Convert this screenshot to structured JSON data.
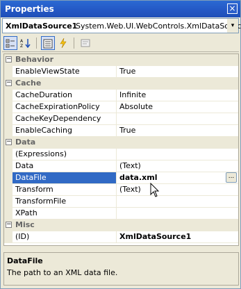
{
  "window": {
    "title": "Properties",
    "close_glyph": "×"
  },
  "object_selector": {
    "name": "XmlDataSource1",
    "type": "System.Web.UI.WebControls.XmlDataSource",
    "dropdown_glyph": "▾"
  },
  "toolbar": {
    "buttons": [
      {
        "icon": "categorized-icon",
        "pressed": true
      },
      {
        "icon": "alphabetical-icon",
        "pressed": false
      },
      {
        "icon": "properties-icon",
        "pressed": true
      },
      {
        "icon": "events-icon",
        "pressed": false
      },
      {
        "icon": "property-pages-icon",
        "pressed": false
      }
    ]
  },
  "grid": {
    "categories": [
      {
        "label": "Behavior",
        "toggle": "−",
        "props": [
          {
            "name": "EnableViewState",
            "value": "True"
          }
        ]
      },
      {
        "label": "Cache",
        "toggle": "−",
        "props": [
          {
            "name": "CacheDuration",
            "value": "Infinite"
          },
          {
            "name": "CacheExpirationPolicy",
            "value": "Absolute"
          },
          {
            "name": "CacheKeyDependency",
            "value": ""
          },
          {
            "name": "EnableCaching",
            "value": "True"
          }
        ]
      },
      {
        "label": "Data",
        "toggle": "−",
        "props": [
          {
            "name": "(Expressions)",
            "value": ""
          },
          {
            "name": "Data",
            "value": "(Text)"
          },
          {
            "name": "DataFile",
            "value": "data.xml",
            "selected": true,
            "ellipsis": "..."
          },
          {
            "name": "Transform",
            "value": "(Text)"
          },
          {
            "name": "TransformFile",
            "value": ""
          },
          {
            "name": "XPath",
            "value": ""
          }
        ]
      },
      {
        "label": "Misc",
        "toggle": "−",
        "props": [
          {
            "name": "(ID)",
            "value": "XmlDataSource1",
            "bold": true
          }
        ]
      }
    ]
  },
  "help": {
    "title": "DataFile",
    "description": "The path to an XML data file."
  },
  "colors": {
    "titlebar": "#2458C5",
    "selection": "#316AC5",
    "chrome": "#ECE9D8"
  }
}
